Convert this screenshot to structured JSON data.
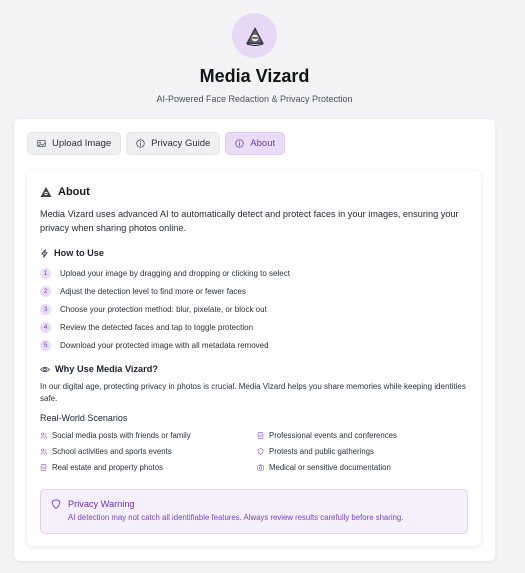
{
  "app": {
    "title": "Media Vizard",
    "subtitle": "AI-Powered Face Redaction & Privacy Protection",
    "logo_icon": "wizard-icon"
  },
  "colors": {
    "accent": "#7a45c0",
    "accent_light": "#eadcf7",
    "background": "#f4f4f6"
  },
  "tabs": [
    {
      "label": "Upload Image",
      "icon": "image-icon",
      "active": false
    },
    {
      "label": "Privacy Guide",
      "icon": "info-icon",
      "active": false
    },
    {
      "label": "About",
      "icon": "info-circle-icon",
      "active": true
    }
  ],
  "about": {
    "title": "About",
    "intro": "Media Vizard uses advanced AI to automatically detect and protect faces in your images, ensuring your privacy when sharing photos online.",
    "how_title": "How to Use",
    "steps": [
      {
        "num": "1",
        "text": "Upload your image by dragging and dropping or clicking to select"
      },
      {
        "num": "2",
        "text": "Adjust the detection level to find more or fewer faces"
      },
      {
        "num": "3",
        "text": "Choose your protection method: blur, pixelate, or block out"
      },
      {
        "num": "4",
        "text": "Review the detected faces and tap to toggle protection"
      },
      {
        "num": "5",
        "text": "Download your protected image with all metadata removed"
      }
    ],
    "why_title": "Why Use Media Vizard?",
    "why_text": "In our digital age, protecting privacy in photos is crucial. Media Vizard helps you share memories while keeping identities safe.",
    "scenarios_title": "Real-World Scenarios",
    "scenarios": [
      {
        "text": "Social media posts with friends or family",
        "icon": "users-icon"
      },
      {
        "text": "Professional events and conferences",
        "icon": "building-icon"
      },
      {
        "text": "School activities and sports events",
        "icon": "users-icon"
      },
      {
        "text": "Protests and public gatherings",
        "icon": "shield-icon"
      },
      {
        "text": "Real estate and property photos",
        "icon": "building-icon"
      },
      {
        "text": "Medical or sensitive documentation",
        "icon": "camera-icon"
      }
    ],
    "warning_title": "Privacy Warning",
    "warning_text": "AI detection may not catch all identifiable features. Always review results carefully before sharing."
  }
}
